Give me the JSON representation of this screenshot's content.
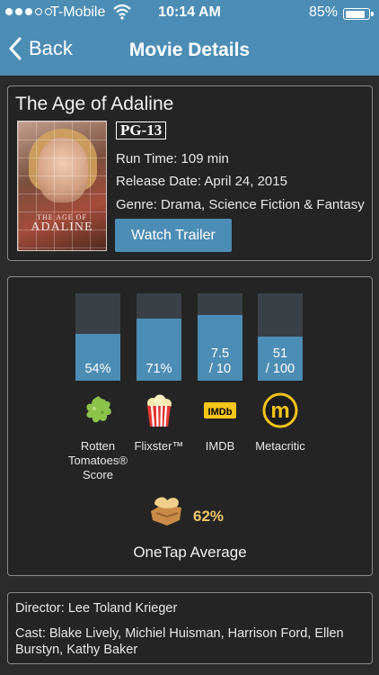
{
  "status_bar": {
    "carrier": "T-Mobile",
    "time": "10:14 AM",
    "battery": "85%"
  },
  "nav": {
    "back": "Back",
    "title": "Movie Details"
  },
  "movie": {
    "title": "The Age of Adaline",
    "rating": "PG-13",
    "runtime": "Run Time: 109 min",
    "release": "Release Date: April 24, 2015",
    "genre": "Genre: Drama, Science Fiction & Fantasy",
    "trailer_button": "Watch Trailer",
    "poster": {
      "line1": "THE AGE OF",
      "line2": "ADALINE"
    }
  },
  "scores": [
    {
      "name": "rotten",
      "fill": 0.54,
      "value": "54%",
      "label": "Rotten Tomatoes® Score"
    },
    {
      "name": "flixster",
      "fill": 0.71,
      "value": "71%",
      "label": "Flixster™"
    },
    {
      "name": "imdb",
      "fill": 0.75,
      "value": "7.5",
      "value2": "/ 10",
      "label": "IMDB"
    },
    {
      "name": "metacritic",
      "fill": 0.51,
      "value": "51",
      "value2": "/ 100",
      "label": "Metacritic"
    }
  ],
  "average": {
    "value": "62%",
    "label": "OneTap Average"
  },
  "crew": {
    "director": "Director: Lee Toland Krieger",
    "cast": "Cast: Blake Lively, Michiel Huisman, Harrison Ford, Ellen Burstyn, Kathy Baker"
  },
  "colors": {
    "accent": "#4c8db5",
    "bar_bg": "#3a4046",
    "average": "#f1c66a"
  }
}
